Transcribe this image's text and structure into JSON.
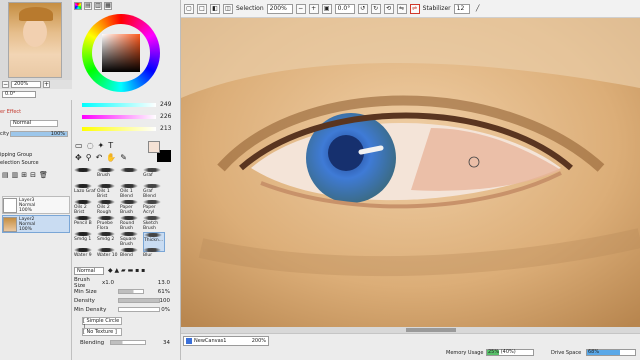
{
  "toolbar": {
    "selection_label": "Selection",
    "zoom": "200%",
    "rotation": "0.0°",
    "stabilizer_label": "Stabilizer",
    "stabilizer_value": "12"
  },
  "navigator": {
    "zoom": "200%",
    "angle": "0.0°"
  },
  "layer_panel": {
    "effect_title": "er Effect",
    "blend_mode": "Normal",
    "opacity_label": "city",
    "opacity_value": "100%",
    "clipping_group": "ipping Group",
    "selection_source": "election Source",
    "layers": [
      {
        "name": "Layer3",
        "mode": "Normal",
        "opacity": "100%"
      },
      {
        "name": "Layer2",
        "mode": "Normal",
        "opacity": "100%"
      }
    ]
  },
  "color_panel": {
    "sliders": [
      {
        "value": "249",
        "color": "#e04a4a"
      },
      {
        "value": "226",
        "color": "#3fb04a"
      },
      {
        "value": "213",
        "color": "#3a6fd8"
      }
    ],
    "current_color": "#f5e2d5"
  },
  "brushes": [
    [
      "",
      "Brush",
      "",
      "Graf"
    ],
    [
      "Lazo Graf",
      "Oils 1 Brist",
      "Oils 1 Blend",
      "Graf Blend"
    ],
    [
      "Oils 2 Brist",
      "Oils 2 Rough",
      "Paper Brush",
      "Paper Acryl"
    ],
    [
      "Pencil B",
      "Pruebe Flora",
      "Round Brush",
      "Sketch Brush"
    ],
    [
      "Smdg 1",
      "Smdg 2",
      "Square Brush",
      "Thickn..."
    ],
    [
      "Water 9",
      "Water 10",
      "Blend",
      "Blur"
    ]
  ],
  "brush_props": {
    "blend_mode": "Normal",
    "size_label": "Brush Size",
    "size_mult": "x1.0",
    "size_value": "13.0",
    "min_size_label": "Min Size",
    "min_size_value": "61%",
    "density_label": "Density",
    "density_value": "100",
    "min_density_label": "Min Density",
    "min_density_value": "0%",
    "shape": "[ Simple Circle ]",
    "texture": "[ No Texture ]",
    "blending_label": "Blending",
    "blending_value": "34"
  },
  "status": {
    "canvas_tab": "NewCanvas1",
    "canvas_zoom": "200%",
    "memory_label": "Memory Usage",
    "memory_value": "25% (40%)",
    "memory_fraction": 0.25,
    "drive_label": "Drive Space",
    "drive_value": "68%",
    "drive_fraction": 0.68
  }
}
